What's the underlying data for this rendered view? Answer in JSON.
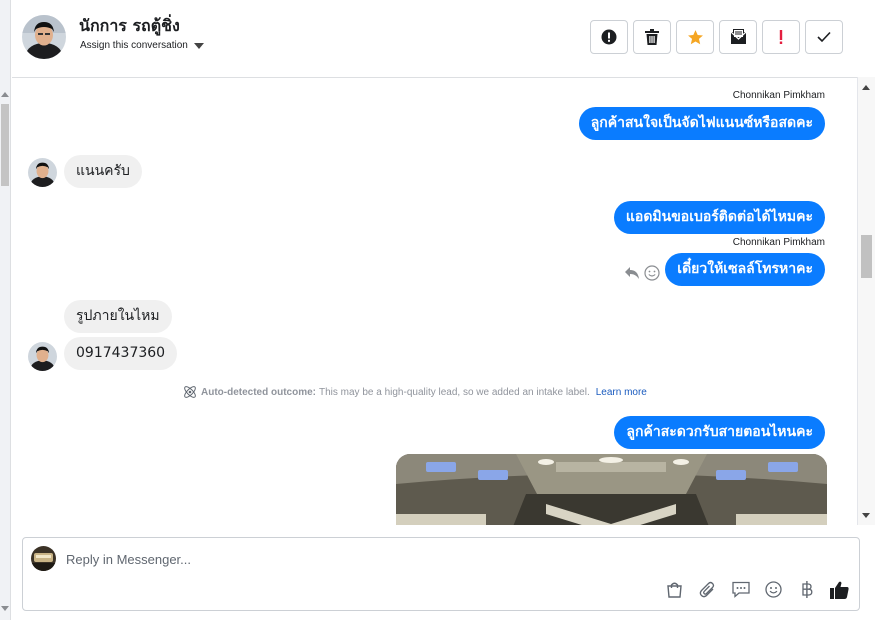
{
  "header": {
    "contact_name": "นักการ รถตู้ชิ่ง",
    "assign_label": "Assign this conversation",
    "action_icons": [
      "mark-spam-icon",
      "trash-icon",
      "star-icon",
      "mark-unread-icon",
      "follow-up-icon",
      "done-check-icon"
    ]
  },
  "messages": [
    {
      "direction": "out",
      "sender": "Chonnikan Pimkham",
      "text": "ลูกค้าสนใจเป็นจัดไฟแนนซ์หรือสดคะ"
    },
    {
      "direction": "in",
      "text": "แนนครับ"
    },
    {
      "direction": "out",
      "text": "แอดมินขอเบอร์ติดต่อได้ไหมคะ"
    },
    {
      "direction": "out",
      "sender": "Chonnikan Pimkham",
      "text": "เดี๋ยวให้เซลล์โทรหาคะ"
    },
    {
      "direction": "in",
      "text": "รูปภายในไหม"
    },
    {
      "direction": "in",
      "text": "0917437360"
    },
    {
      "direction": "out",
      "text": "ลูกค้าสะดวกรับสายตอนไหนคะ"
    }
  ],
  "auto_outcome": {
    "label": "Auto-detected outcome:",
    "text": "This may be a high-quality lead, so we added an intake label.",
    "link": "Learn more"
  },
  "composer": {
    "placeholder": "Reply in Messenger...",
    "tool_icons": [
      "shop-bag-icon",
      "attachment-icon",
      "saved-reply-icon",
      "emoji-icon",
      "baht-payment-icon",
      "like-icon"
    ]
  },
  "colors": {
    "outgoing_bubble": "#0a7cff",
    "incoming_bubble": "#f0f0f0",
    "star": "#f5a623",
    "flag_red": "#e41e3f"
  }
}
